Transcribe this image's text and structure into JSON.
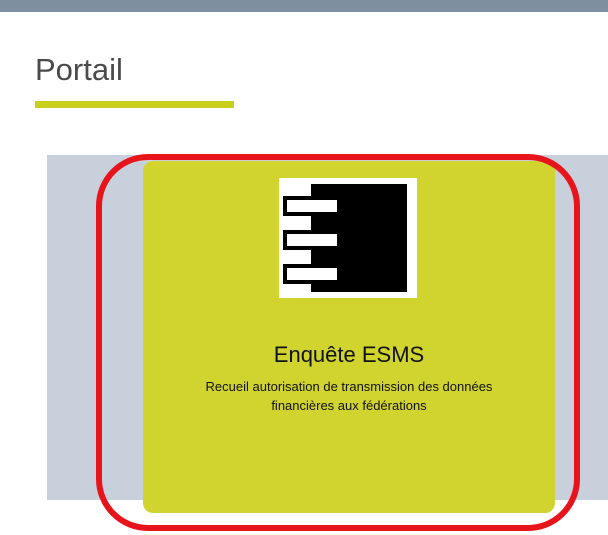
{
  "page": {
    "title": "Portail"
  },
  "tile": {
    "title": "Enquête ESMS",
    "description": "Recueil autorisation de transmission des données financières aux fédérations",
    "icon": "component-icon"
  },
  "colors": {
    "top_bar": "#7e8fa0",
    "accent": "#c9d01c",
    "panel_background": "#c8d0db",
    "tile_background": "#d1d42e",
    "highlight": "#e8141c"
  }
}
